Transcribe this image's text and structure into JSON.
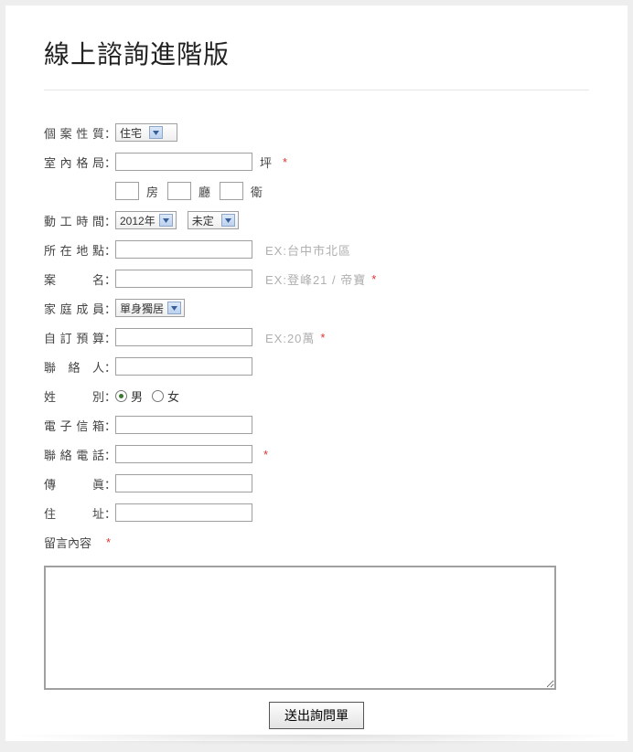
{
  "title": "線上諮詢進階版",
  "labels": {
    "case_type": "個案性質",
    "layout": "室內格局",
    "start_time": "動工時間",
    "location": "所在地點",
    "case_name": "案　　名",
    "family": "家庭成員",
    "budget": "自訂預算",
    "contact": "聯 絡 人",
    "gender": "姓　　別",
    "email": "電子信箱",
    "phone": "聯絡電話",
    "fax": "傳　　眞",
    "address": "住　　址",
    "message": "留言內容"
  },
  "values": {
    "case_type": "住宅",
    "year": "2012年",
    "month": "未定",
    "family": "單身獨居"
  },
  "units": {
    "ping": "坪",
    "room": "房",
    "hall": "廳",
    "bath": "衛"
  },
  "hints": {
    "location": "EX:台中市北區",
    "case_name": "EX:登峰21 / 帝寶",
    "budget": "EX:20萬"
  },
  "gender": {
    "male": "男",
    "female": "女"
  },
  "required_mark": "*",
  "submit": "送出詢問單"
}
